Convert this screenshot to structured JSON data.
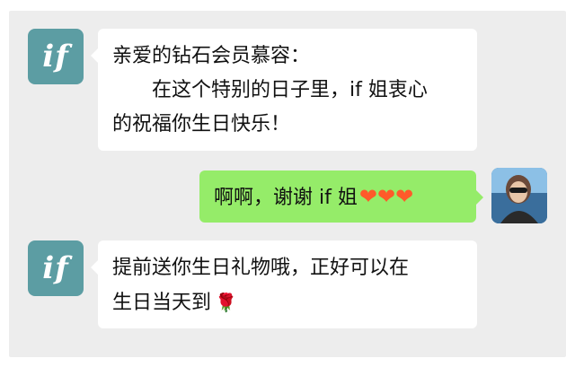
{
  "messages": [
    {
      "sender": "if",
      "avatar_text": "if",
      "lines": [
        "亲爱的钻石会员慕容：",
        "在这个特别的日子里，if 姐衷心",
        "的祝福你生日快乐！"
      ]
    },
    {
      "sender": "user",
      "text": "啊啊，谢谢 if 姐",
      "emoji": "❤❤❤"
    },
    {
      "sender": "if",
      "avatar_text": "if",
      "lines": [
        "提前送你生日礼物哦，正好可以在",
        "生日当天到"
      ],
      "emoji": "🌹"
    }
  ],
  "colors": {
    "background": "#ededed",
    "brand_avatar": "#5c9da3",
    "sent_bubble": "#95ec69",
    "received_bubble": "#ffffff"
  },
  "icons": {
    "heart": "heart-icon",
    "rose": "rose-icon"
  }
}
